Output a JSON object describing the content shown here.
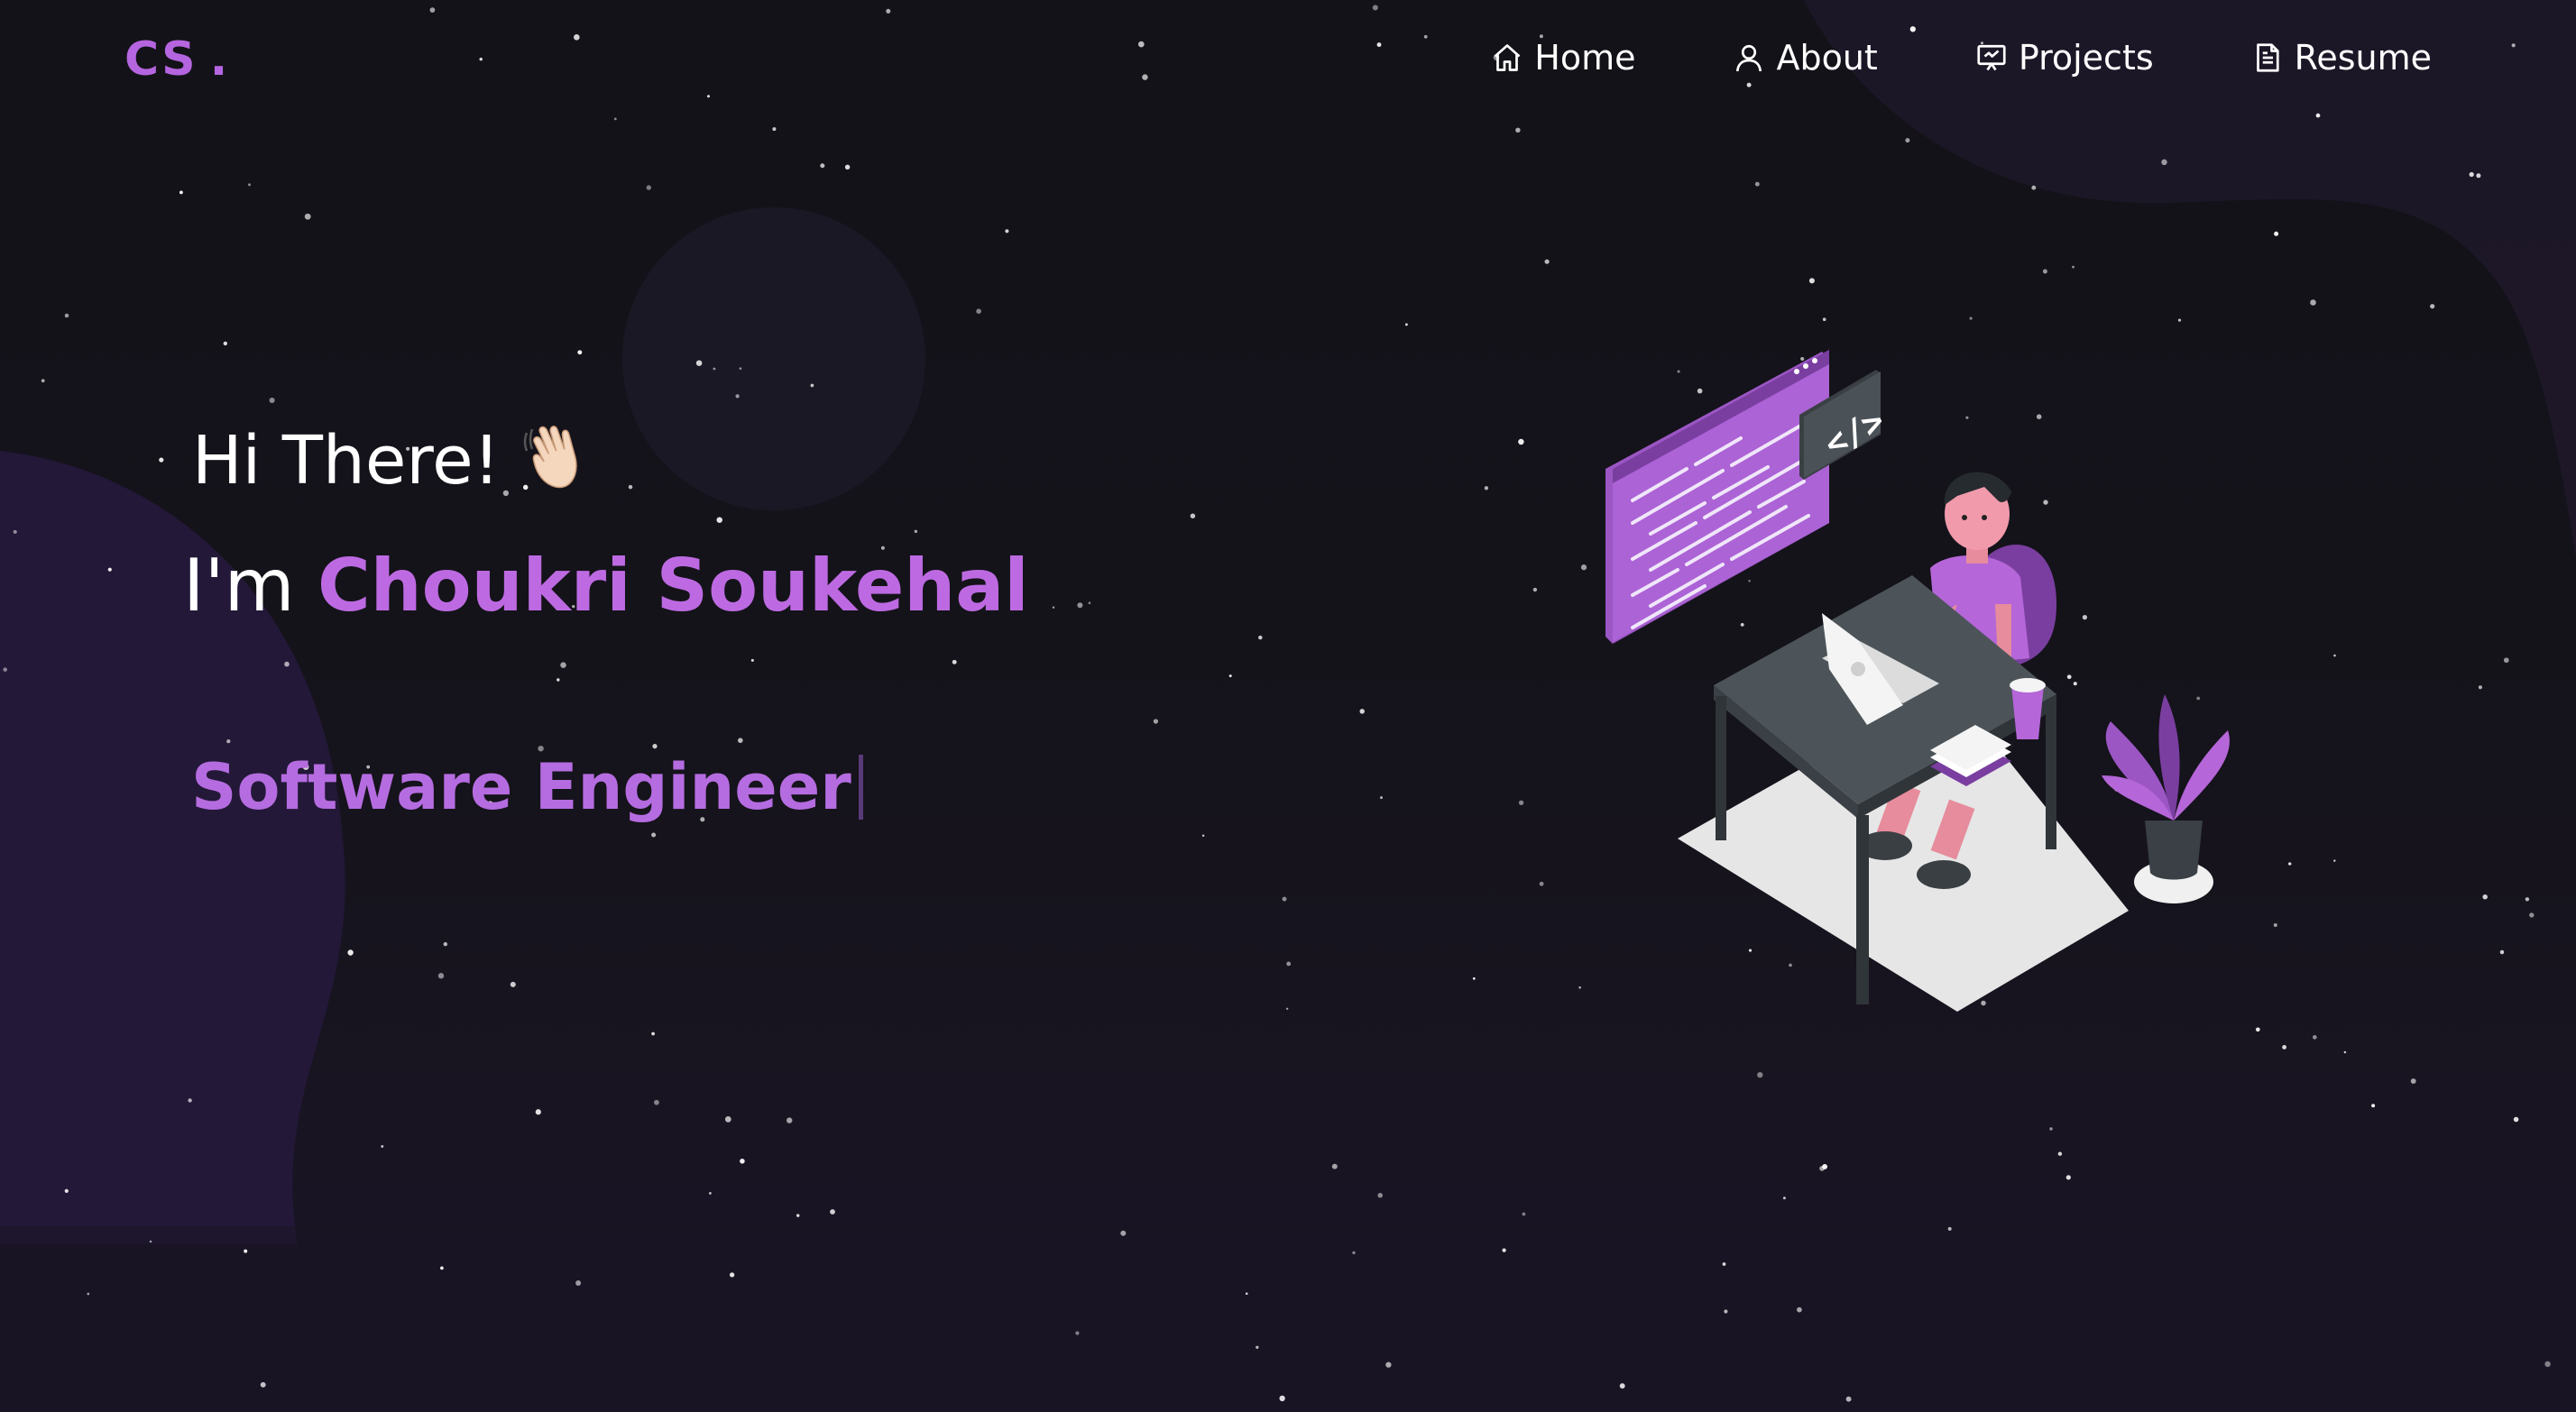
{
  "logo": {
    "text": "CS",
    "dot": "."
  },
  "nav": {
    "items": [
      {
        "label": "Home",
        "icon": "home-icon"
      },
      {
        "label": "About",
        "icon": "user-icon"
      },
      {
        "label": "Projects",
        "icon": "presentation-icon"
      },
      {
        "label": "Resume",
        "icon": "document-icon"
      }
    ]
  },
  "hero": {
    "greeting": "Hi There!",
    "wave_emoji": "👋🏻",
    "intro_prefix": "I'm",
    "name": "Choukri Soukehal",
    "typed_role": "Software Engineer"
  },
  "colors": {
    "accent": "#b565e0",
    "background": "#141219",
    "text": "#ffffff"
  }
}
